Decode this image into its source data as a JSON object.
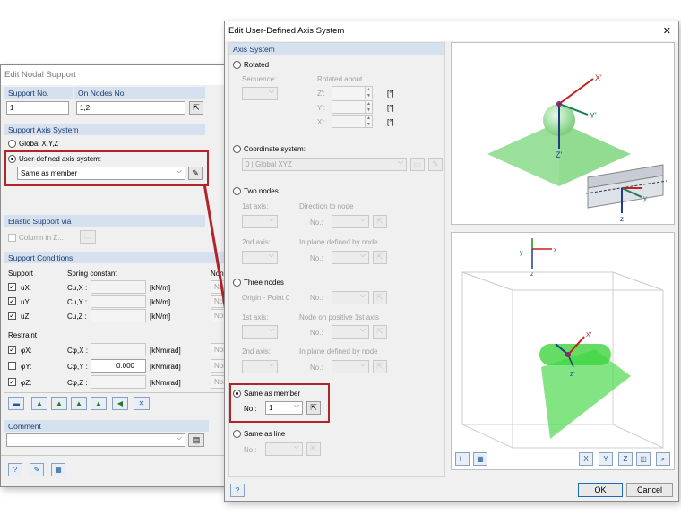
{
  "nodal": {
    "title": "Edit Nodal Support",
    "support_no_label": "Support No.",
    "on_nodes_label": "On Nodes No.",
    "support_no": "1",
    "on_nodes": "1,2",
    "axis_system_header": "Support Axis System",
    "global_label": "Global X,Y,Z",
    "user_defined_label": "User-defined axis system:",
    "user_defined_value": "Same as member",
    "elastic_header": "Elastic Support via",
    "column_label": "Column in Z...",
    "conditions_header": "Support Conditions",
    "col_support": "Support",
    "col_spring": "Spring constant",
    "col_nonlin": "Nonl",
    "support_rows": [
      {
        "label": "uX:",
        "coef": "Cu,X :",
        "unit": "[kN/m]",
        "value": "",
        "nonlin": "None"
      },
      {
        "label": "uY:",
        "coef": "Cu,Y :",
        "unit": "[kN/m]",
        "value": "",
        "nonlin": "None"
      },
      {
        "label": "uZ:",
        "coef": "Cu,Z :",
        "unit": "[kN/m]",
        "value": "",
        "nonlin": "None"
      }
    ],
    "restraint_label": "Restraint",
    "restraint_rows": [
      {
        "label": "φX:",
        "coef": "Cφ,X :",
        "unit": "[kNm/rad]",
        "value": "",
        "checked": true,
        "nonlin": "None"
      },
      {
        "label": "φY:",
        "coef": "Cφ,Y :",
        "unit": "[kNm/rad]",
        "value": "0.000",
        "checked": false,
        "nonlin": "None"
      },
      {
        "label": "φZ:",
        "coef": "Cφ,Z :",
        "unit": "[kNm/rad]",
        "value": "",
        "checked": true,
        "nonlin": "None"
      }
    ],
    "comment_header": "Comment"
  },
  "axis": {
    "title": "Edit User-Defined Axis System",
    "close": "✕",
    "group_header": "Axis System",
    "rotated": "Rotated",
    "sequence": "Sequence:",
    "rotated_about": "Rotated about",
    "z_rot": "Z':",
    "y_rot": "Y':",
    "x_rot": "X':",
    "deg": "[°]",
    "coord_system": "Coordinate system:",
    "coord_value": "0 | Global XYZ",
    "two_nodes": "Two nodes",
    "first_axis": "1st axis:",
    "direction_to_node": "Direction to node",
    "no_label": "No.:",
    "second_axis": "2nd axis:",
    "in_plane_node": "In plane defined by node",
    "three_nodes": "Three nodes",
    "origin": "Origin - Point 0",
    "node_positive": "Node on positive 1st axis",
    "same_member": "Same as member",
    "member_no": "1",
    "same_line": "Same as line",
    "ok": "OK",
    "cancel": "Cancel",
    "axis_labels": {
      "x": "X'",
      "y": "Y'",
      "z": "Z'",
      "gx": "x",
      "gy": "y",
      "gz": "z"
    }
  },
  "colors": {
    "accent": "#b4232a",
    "group": "#d6e1ef",
    "green": "#5ee05e"
  }
}
